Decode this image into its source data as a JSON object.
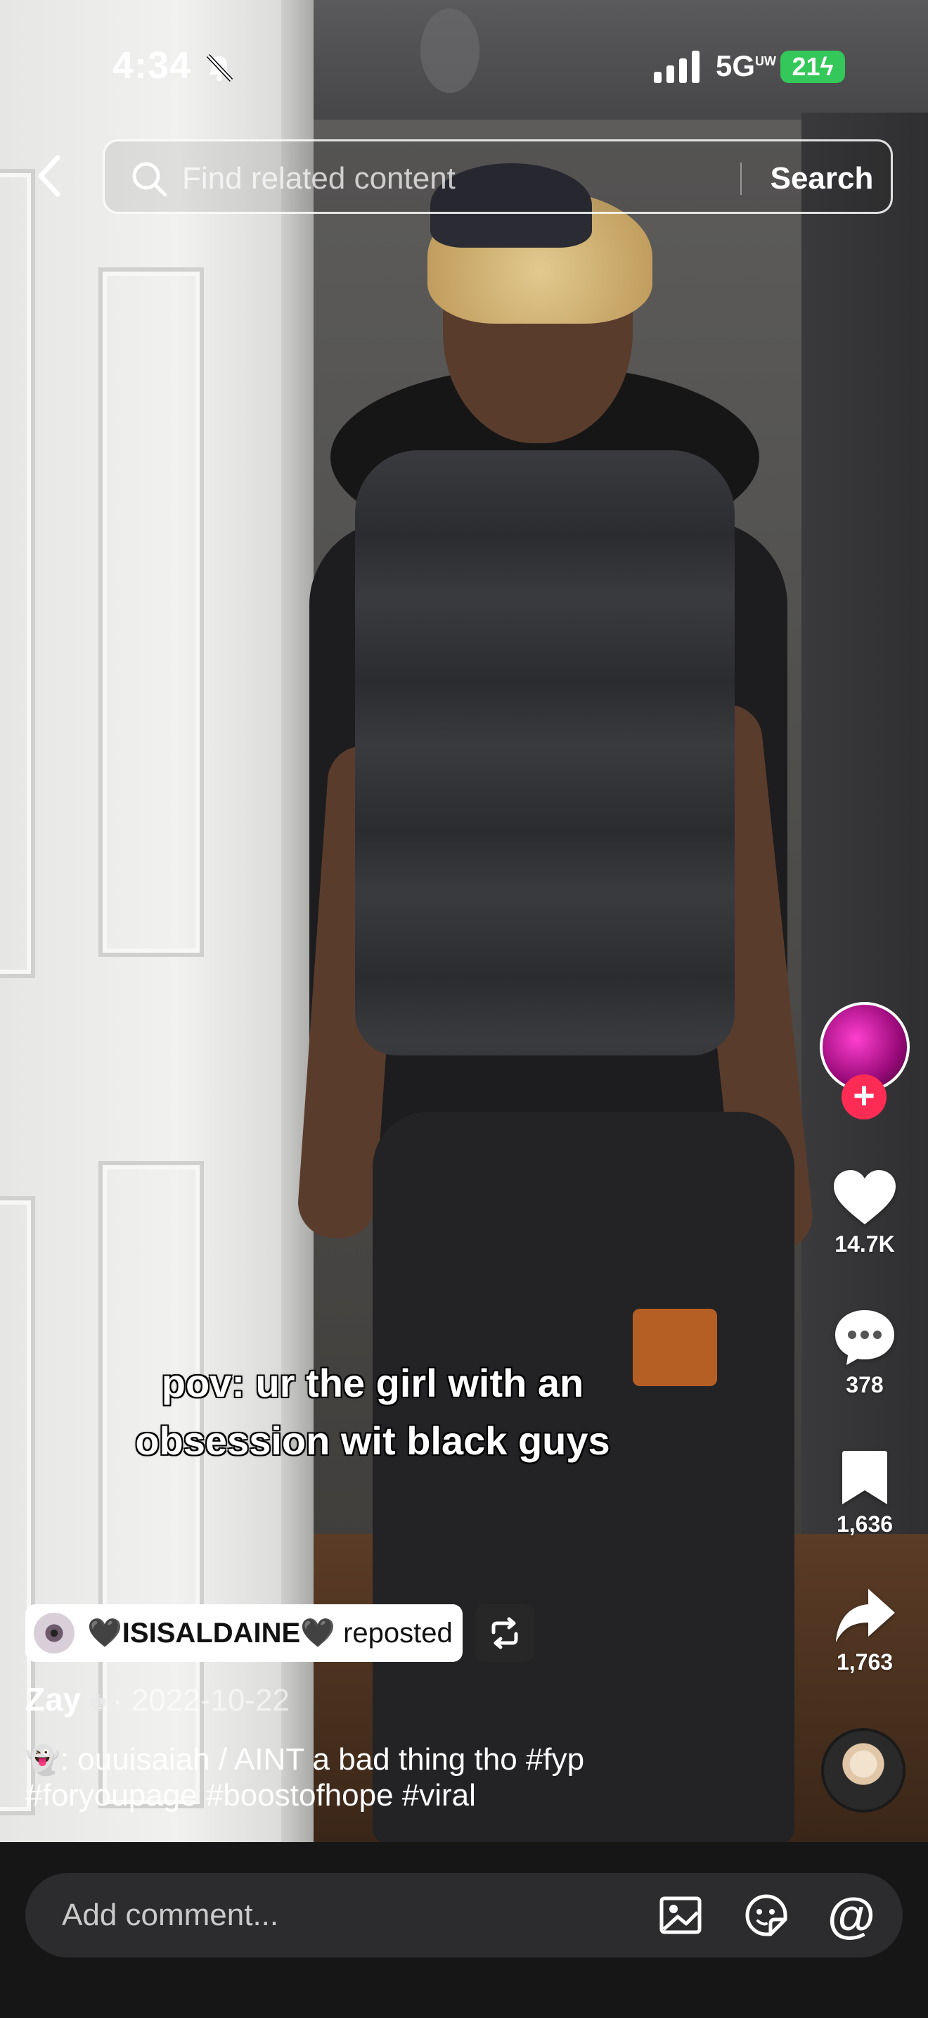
{
  "status_bar": {
    "time": "4:34",
    "network": "5G",
    "network_suffix": "UW",
    "battery": "21"
  },
  "search": {
    "placeholder": "Find related content",
    "button_label": "Search"
  },
  "video": {
    "caption_line1": "pov: ur the girl with an",
    "caption_line2": "obsession wit black guys"
  },
  "actions": {
    "likes": "14.7K",
    "comments": "378",
    "favorites": "1,636",
    "shares": "1,763"
  },
  "repost": {
    "user": "🖤ISISALDAINE🖤",
    "label": "reposted"
  },
  "post": {
    "author": "Zay",
    "date": "· 2022-10-22",
    "description_line1": ": ouuisaiah / AINT a bad thing tho #fyp",
    "description_line2": "#foryoupage #boostofhope #viral"
  },
  "comment_bar": {
    "placeholder": "Add comment..."
  },
  "icons": {
    "back": "chevron-left-icon",
    "search": "search-icon",
    "like": "heart-icon",
    "comment": "comment-icon",
    "favorite": "bookmark-icon",
    "share": "share-icon",
    "repost": "repost-icon",
    "image": "image-icon",
    "sticker": "sticker-icon",
    "mention": "at-icon"
  },
  "colors": {
    "follow_accent": "#fe2c55",
    "battery_green": "#34c759",
    "bottom_bar": "#161616"
  }
}
